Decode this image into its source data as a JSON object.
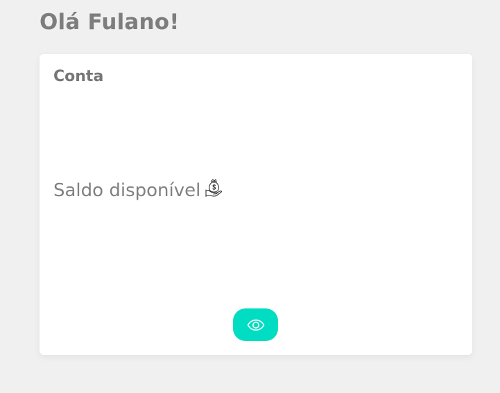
{
  "header": {
    "greeting": "Olá Fulano!"
  },
  "account_card": {
    "title": "Conta",
    "balance_label": "Saldo disponível",
    "balance_icon": "money-bag-icon",
    "toggle_icon": "eye-icon"
  },
  "colors": {
    "background": "#f0f0f0",
    "card": "#ffffff",
    "accent": "#00ddc2",
    "text": "#7d7d7d"
  }
}
